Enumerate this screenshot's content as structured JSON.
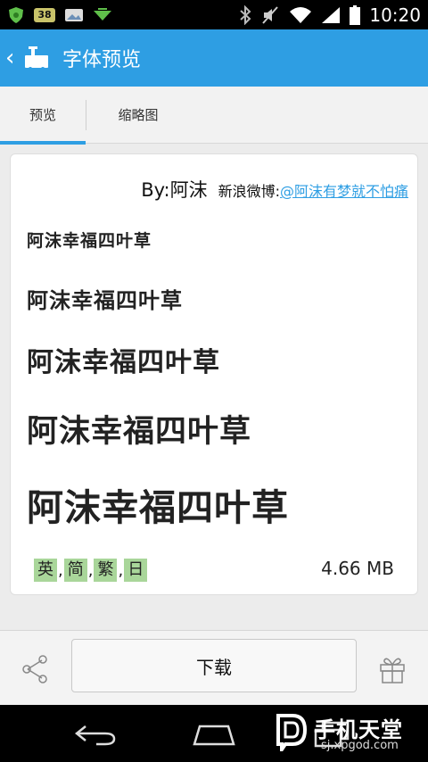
{
  "status_bar": {
    "badge": "38",
    "time": "10:20",
    "icons": [
      "shield-icon",
      "notification-badge",
      "gallery-icon",
      "download-icon",
      "bluetooth-icon",
      "mute-icon",
      "wifi-icon",
      "signal-icon",
      "battery-icon"
    ]
  },
  "header": {
    "title": "字体预览",
    "icons": [
      "chevron-left-icon",
      "app-font-icon"
    ]
  },
  "tabs": [
    {
      "label": "预览",
      "active": true
    },
    {
      "label": "缩略图",
      "active": false
    }
  ],
  "card": {
    "author": "By:阿沫",
    "weibo_label": "新浪微博:",
    "weibo_link": "@阿沫有梦就不怕痛",
    "samples": [
      "阿沫幸福四叶草",
      "阿沫幸福四叶草",
      "阿沫幸福四叶草",
      "阿沫幸福四叶草",
      "阿沫幸福四叶草"
    ],
    "languages": [
      "英",
      "简",
      "繁",
      "日"
    ],
    "separator": ",",
    "file_size": "4.66 MB"
  },
  "actions": {
    "download_label": "下载",
    "icons": [
      "share-icon",
      "gift-icon"
    ]
  },
  "nav_bar": {
    "icons": [
      "back-icon",
      "home-icon",
      "recent-apps-icon"
    ]
  },
  "watermark": {
    "title": "手机天堂",
    "url": "sj.xpgod.com"
  },
  "colors": {
    "accent": "#2e9ee3",
    "language_tag": "#a9d69a",
    "background": "#ececec"
  }
}
